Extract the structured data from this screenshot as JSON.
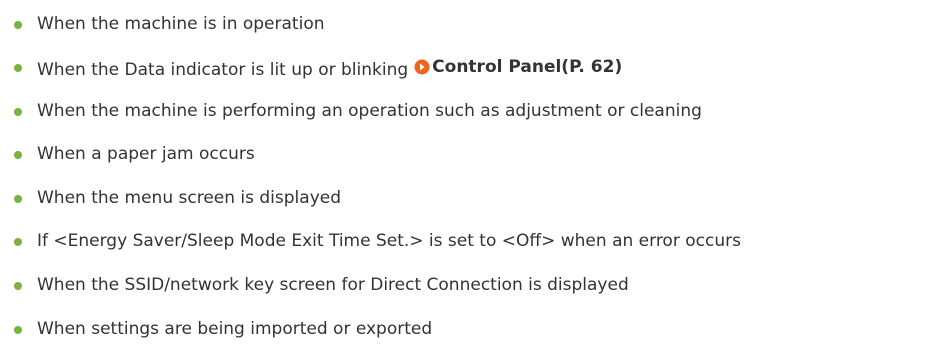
{
  "bullet_color": "#78b43c",
  "link_icon_color": "#f0641e",
  "items": [
    {
      "text": "When the machine is in operation"
    },
    {
      "text": "When the Data indicator is lit up or blinking",
      "link": {
        "icon": "arrow-right-circle-icon",
        "label": "Control Panel(P. 62)"
      }
    },
    {
      "text": "When the machine is performing an operation such as adjustment or cleaning"
    },
    {
      "text": "When a paper jam occurs"
    },
    {
      "text": "When the menu screen is displayed"
    },
    {
      "text": "If <Energy Saver/Sleep Mode Exit Time Set.> is set to <Off> when an error occurs"
    },
    {
      "text": "When the SSID/network key screen for Direct Connection is displayed"
    },
    {
      "text": "When settings are being imported or exported"
    }
  ]
}
